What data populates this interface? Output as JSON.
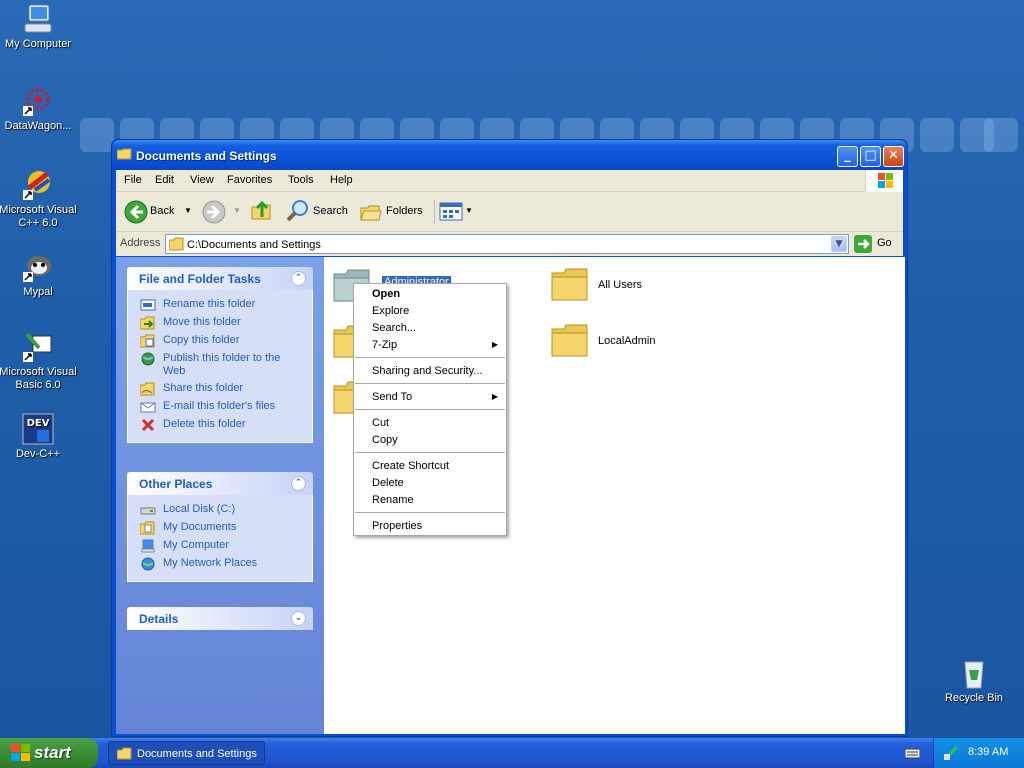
{
  "desktop": {
    "icons": [
      {
        "label": "My Computer",
        "icon": "computer-icon"
      },
      {
        "label": "DataWagon...",
        "icon": "datawagon-icon"
      },
      {
        "label": "Microsoft Visual C++ 6.0",
        "icon": "visual-cpp-icon"
      },
      {
        "label": "Mypal",
        "icon": "mypal-icon"
      },
      {
        "label": "Microsoft Visual Basic 6.0",
        "icon": "visual-basic-icon"
      },
      {
        "label": "Dev-C++",
        "icon": "devcpp-icon"
      },
      {
        "label": "Recycle Bin",
        "icon": "recycle-bin-icon"
      }
    ]
  },
  "window": {
    "title": "Documents and Settings",
    "menu": [
      "File",
      "Edit",
      "View",
      "Favorites",
      "Tools",
      "Help"
    ],
    "toolbar": {
      "back": "Back",
      "search": "Search",
      "folders": "Folders"
    },
    "address": {
      "label": "Address",
      "value": "C:\\Documents and Settings",
      "go": "Go"
    }
  },
  "left_pane": {
    "file_tasks": {
      "title": "File and Folder Tasks",
      "items": [
        {
          "label": "Rename this folder",
          "icon": "rename-icon"
        },
        {
          "label": "Move this folder",
          "icon": "move-icon"
        },
        {
          "label": "Copy this folder",
          "icon": "copy-icon"
        },
        {
          "label": "Publish this folder to the Web",
          "icon": "publish-web-icon"
        },
        {
          "label": "Share this folder",
          "icon": "share-icon"
        },
        {
          "label": "E-mail this folder's files",
          "icon": "email-icon"
        },
        {
          "label": "Delete this folder",
          "icon": "delete-icon"
        }
      ]
    },
    "other_places": {
      "title": "Other Places",
      "items": [
        {
          "label": "Local Disk (C:)",
          "icon": "disk-icon"
        },
        {
          "label": "My Documents",
          "icon": "my-documents-icon"
        },
        {
          "label": "My Computer",
          "icon": "computer-icon"
        },
        {
          "label": "My Network Places",
          "icon": "network-icon"
        }
      ]
    },
    "details": {
      "title": "Details"
    }
  },
  "content": {
    "folders": [
      {
        "label": "Administrator",
        "selected": true
      },
      {
        "label": "All Users"
      },
      {
        "label": "LocalAdmin"
      }
    ]
  },
  "context_menu": {
    "items": [
      "Open",
      "Explore",
      "Search...",
      "7-Zip",
      "Sharing and Security...",
      "Send To",
      "Cut",
      "Copy",
      "Create Shortcut",
      "Delete",
      "Rename",
      "Properties"
    ]
  },
  "taskbar": {
    "start": "start",
    "task": "Documents and Settings",
    "clock": "8:39 AM"
  },
  "colors": {
    "desktop": "#1f5ea8",
    "title_bar": "#0c52d8",
    "task_pane": "#6483d6",
    "start_button": "#3c8c36"
  }
}
